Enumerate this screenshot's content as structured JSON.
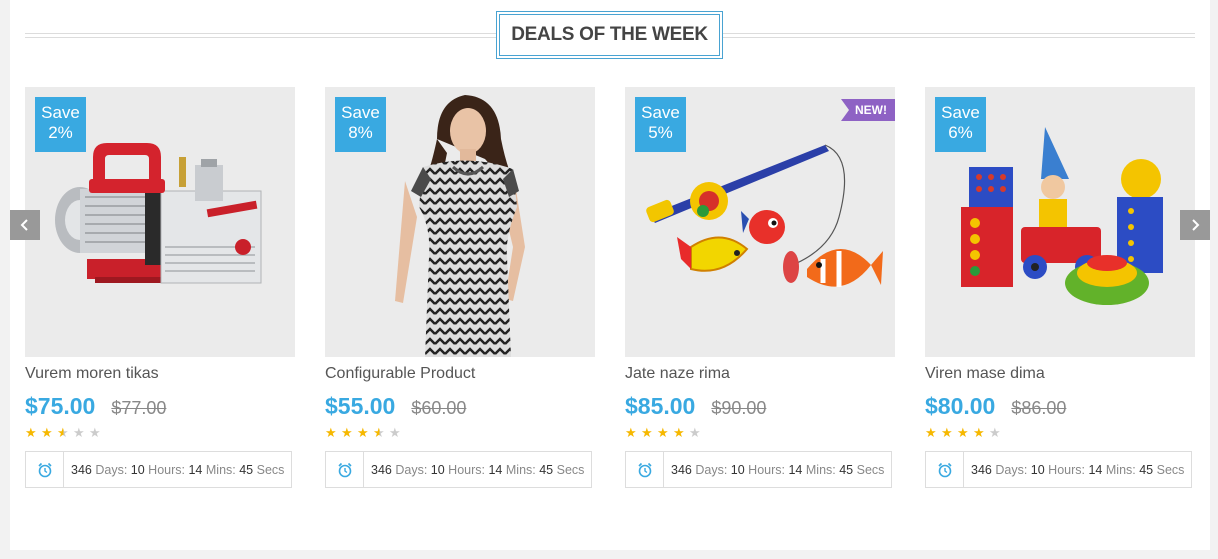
{
  "section": {
    "title": "DEALS OF THE WEEK"
  },
  "accent_color": "#39a9e1",
  "save_prefix": "Save",
  "timer_units": {
    "days": "Days:",
    "hours": "Hours:",
    "mins": "Mins:",
    "secs": "Secs"
  },
  "products": [
    {
      "name": "Vurem moren tikas",
      "price": "$75.00",
      "old_price": "$77.00",
      "save": "2%",
      "rating": 2.5,
      "new": false,
      "timer": {
        "days": "346",
        "hours": "10",
        "mins": "14",
        "secs": "45"
      }
    },
    {
      "name": "Configurable Product",
      "price": "$55.00",
      "old_price": "$60.00",
      "save": "8%",
      "rating": 3.5,
      "new": false,
      "timer": {
        "days": "346",
        "hours": "10",
        "mins": "14",
        "secs": "45"
      }
    },
    {
      "name": "Jate naze rima",
      "price": "$85.00",
      "old_price": "$90.00",
      "save": "5%",
      "rating": 4,
      "new": true,
      "new_label": "NEW!",
      "timer": {
        "days": "346",
        "hours": "10",
        "mins": "14",
        "secs": "45"
      }
    },
    {
      "name": "Viren mase dima",
      "price": "$80.00",
      "old_price": "$86.00",
      "save": "6%",
      "rating": 4,
      "new": false,
      "timer": {
        "days": "346",
        "hours": "10",
        "mins": "14",
        "secs": "45"
      }
    }
  ],
  "icons": {
    "prev": "chevron-left-icon",
    "next": "chevron-right-icon",
    "timer": "alarm-clock-icon",
    "star": "star-icon"
  }
}
